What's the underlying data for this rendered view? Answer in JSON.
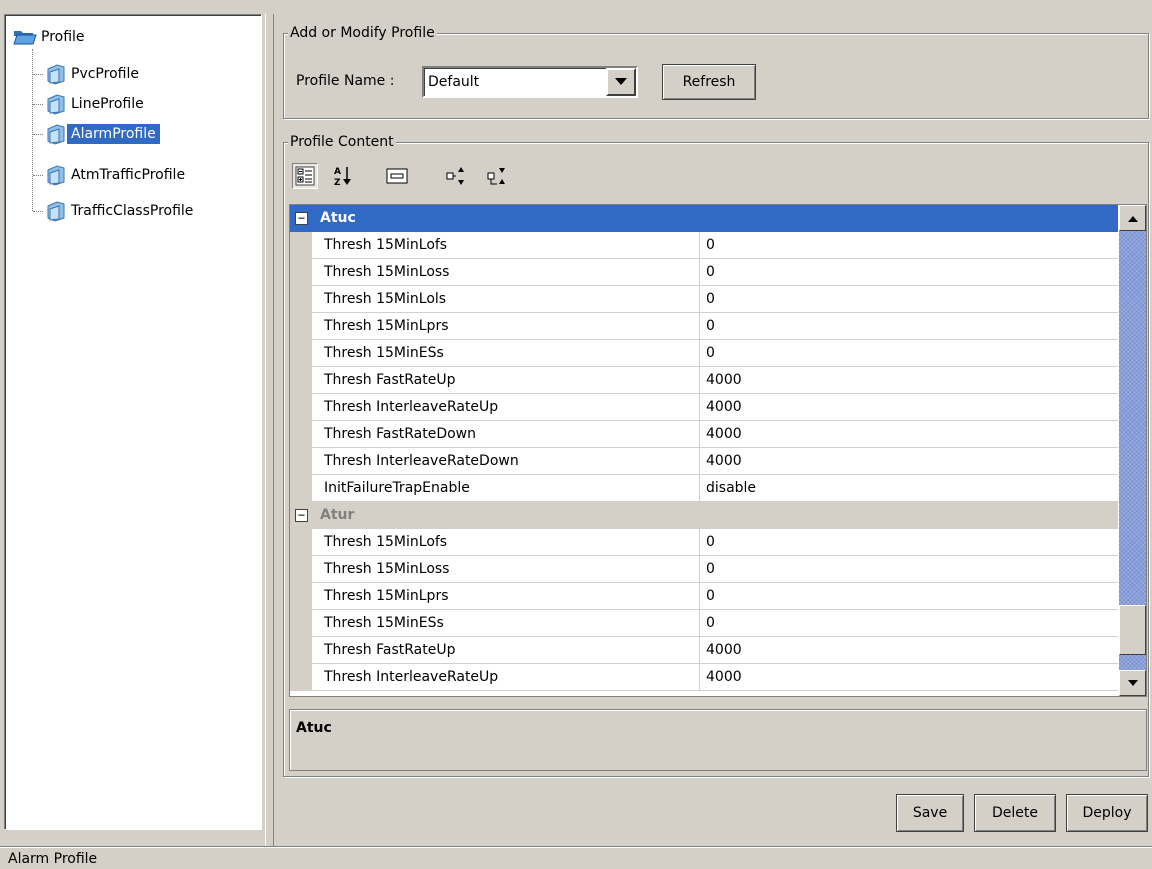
{
  "tree": {
    "root": "Profile",
    "items": [
      {
        "label": "PvcProfile"
      },
      {
        "label": "LineProfile"
      },
      {
        "label": "AlarmProfile",
        "selected": true
      },
      {
        "label": "AtmTrafficProfile"
      },
      {
        "label": "TrafficClassProfile"
      }
    ]
  },
  "modify": {
    "group_title": "Add or Modify Profile",
    "profile_name_label": "Profile Name :",
    "profile_name_value": "Default",
    "refresh_label": "Refresh"
  },
  "content": {
    "group_title": "Profile Content",
    "toolbar": [
      "categorized-view-icon",
      "sort-alphabetical-icon",
      "description-toggle-icon",
      "expand-all-icon",
      "collapse-all-icon"
    ],
    "categories": [
      {
        "name": "Atuc",
        "toggle": "⊟",
        "rows": [
          {
            "name": "Thresh 15MinLofs",
            "value": "0"
          },
          {
            "name": "Thresh 15MinLoss",
            "value": "0"
          },
          {
            "name": "Thresh 15MinLols",
            "value": "0"
          },
          {
            "name": "Thresh 15MinLprs",
            "value": "0"
          },
          {
            "name": "Thresh 15MinESs",
            "value": "0"
          },
          {
            "name": "Thresh FastRateUp",
            "value": "4000"
          },
          {
            "name": "Thresh InterleaveRateUp",
            "value": "4000"
          },
          {
            "name": "Thresh FastRateDown",
            "value": "4000"
          },
          {
            "name": "Thresh InterleaveRateDown",
            "value": "4000"
          },
          {
            "name": "InitFailureTrapEnable",
            "value": "disable"
          }
        ]
      },
      {
        "name": "Atur",
        "toggle": "⊟",
        "rows": [
          {
            "name": "Thresh 15MinLofs",
            "value": "0"
          },
          {
            "name": "Thresh 15MinLoss",
            "value": "0"
          },
          {
            "name": "Thresh 15MinLprs",
            "value": "0"
          },
          {
            "name": "Thresh 15MinESs",
            "value": "0"
          },
          {
            "name": "Thresh FastRateUp",
            "value": "4000"
          },
          {
            "name": "Thresh InterleaveRateUp",
            "value": "4000"
          }
        ]
      }
    ],
    "description_title": "Atuc"
  },
  "actions": {
    "save_label": "Save",
    "delete_label": "Delete",
    "deploy_label": "Deploy"
  },
  "status": "Alarm Profile",
  "colors": {
    "selection": "#316ac5",
    "panel": "#d4d0c8"
  }
}
